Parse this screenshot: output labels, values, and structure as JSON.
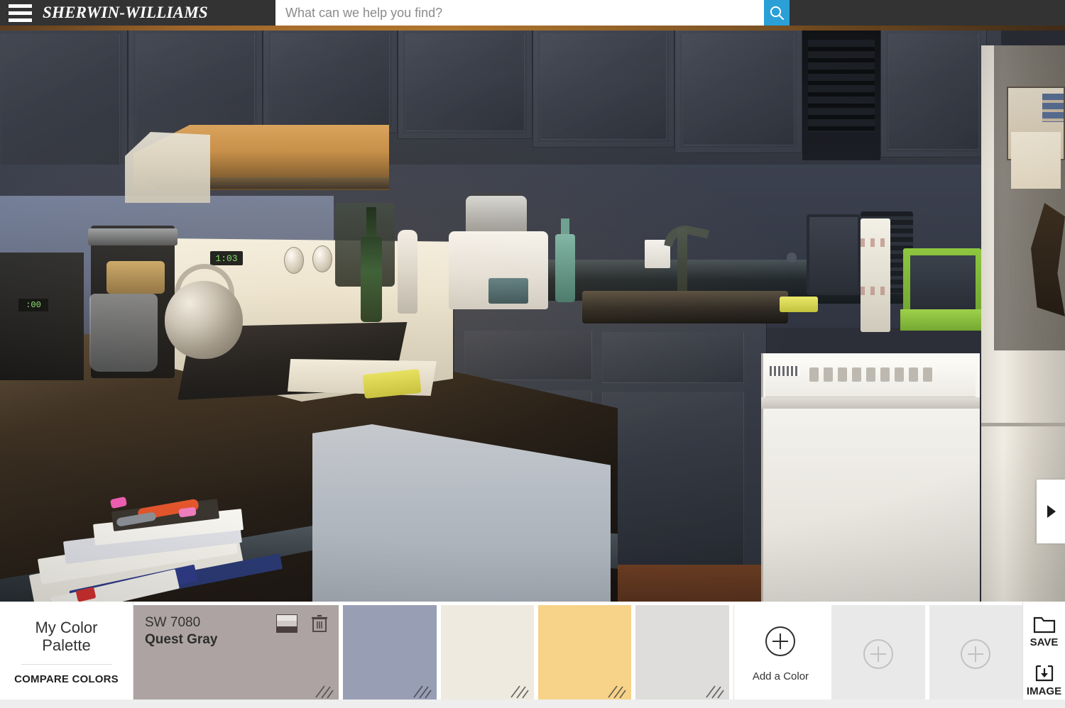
{
  "header": {
    "menu_icon": "hamburger-menu-icon",
    "brand": "Sherwin-Williams",
    "brand_suffix": ".",
    "search": {
      "placeholder": "What can we help you find?",
      "value": "",
      "button_icon": "search-icon",
      "button_color": "#2aa0d6"
    }
  },
  "viewer": {
    "scene": "kitchen-photo",
    "next_arrow_icon": "chevron-right-icon"
  },
  "palette": {
    "title_line1": "My Color",
    "title_line2": "Palette",
    "compare_label": "COMPARE COLORS",
    "swatches": [
      {
        "code": "SW 7080",
        "name": "Quest Gray",
        "color": "#aca3a2",
        "selected": true,
        "has_shade_icon": true,
        "shade_icon": "color-family-stripes-icon",
        "has_delete_icon": true,
        "delete_icon": "trash-icon",
        "resize_icon": "resize-corner-icon"
      },
      {
        "code": "",
        "name": "",
        "color": "#989eb4",
        "selected": false,
        "resize_icon": "resize-corner-icon"
      },
      {
        "code": "",
        "name": "",
        "color": "#efeae0",
        "selected": false,
        "resize_icon": "resize-corner-icon"
      },
      {
        "code": "",
        "name": "",
        "color": "#f7d289",
        "selected": false,
        "resize_icon": "resize-corner-icon"
      },
      {
        "code": "",
        "name": "",
        "color": "#dedddb",
        "selected": false,
        "resize_icon": "resize-corner-icon"
      }
    ],
    "add_color": {
      "label": "Add a Color",
      "icon": "plus-circle-icon"
    },
    "empty_slots": [
      {
        "icon": "plus-circle-icon",
        "disabled": true
      },
      {
        "icon": "plus-circle-icon",
        "disabled": true
      }
    ],
    "actions": [
      {
        "label": "SAVE",
        "icon": "folder-icon"
      },
      {
        "label": "IMAGE",
        "icon": "download-image-icon"
      }
    ]
  }
}
